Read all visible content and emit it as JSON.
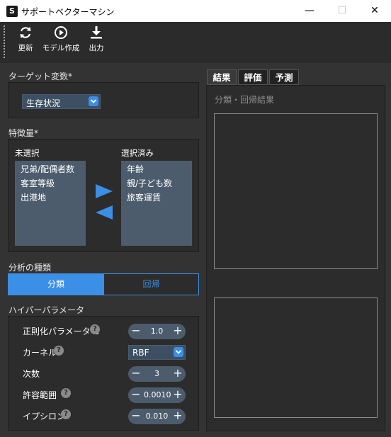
{
  "window": {
    "app_icon_letter": "S",
    "title": "サポートベクターマシン",
    "minimize_glyph": "—",
    "maximize_glyph": "☐",
    "close_glyph": "✕"
  },
  "toolbar": {
    "items": [
      {
        "label": "更新",
        "icon": "refresh-icon"
      },
      {
        "label": "モデル作成",
        "icon": "play-circle-icon"
      },
      {
        "label": "出力",
        "icon": "download-icon"
      }
    ]
  },
  "target": {
    "section_title": "ターゲット変数*",
    "selected": "生存状況"
  },
  "features": {
    "section_title": "特徴量*",
    "unselected_label": "未選択",
    "selected_label": "選択済み",
    "unselected_items": [
      "兄弟/配偶者数",
      "客室等級",
      "出港地"
    ],
    "selected_items": [
      "年齢",
      "親/子ども数",
      "旅客運賃"
    ]
  },
  "analysis": {
    "section_title": "分析の種類",
    "options": [
      "分類",
      "回帰"
    ],
    "active": "分類"
  },
  "hyper": {
    "section_title": "ハイパーパラメータ",
    "params": [
      {
        "label": "正則化パラメータ C",
        "type": "stepper",
        "value": "1.0"
      },
      {
        "label": "カーネル",
        "type": "select",
        "value": "RBF"
      },
      {
        "label": "次数",
        "type": "stepper",
        "value": "3"
      },
      {
        "label": "許容範囲",
        "type": "stepper",
        "value": "0.0010"
      },
      {
        "label": "イプシロン",
        "type": "stepper",
        "value": "0.010"
      }
    ],
    "help_glyph": "?",
    "minus_glyph": "−",
    "plus_glyph": "+"
  },
  "results": {
    "tabs": [
      "結果",
      "評価",
      "予測"
    ],
    "active_tab": "結果",
    "heading": "分類・回帰結果"
  },
  "colors": {
    "accent": "#3b8fe6",
    "control_bg": "#4c5c6d",
    "panel_bg": "#2c2c2c"
  }
}
